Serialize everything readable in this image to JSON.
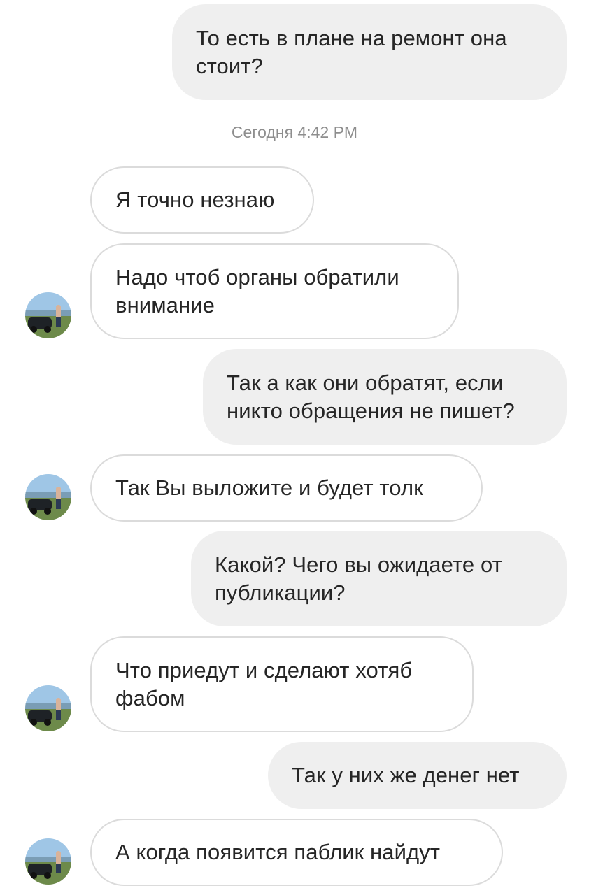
{
  "chat": {
    "timestamp": "Сегодня 4:42 PM",
    "messages": [
      {
        "from": "me",
        "text": "То есть в плане на ремонт она стоит?"
      },
      {
        "from": "them",
        "text": "Я точно незнаю"
      },
      {
        "from": "them",
        "text": "Надо чтоб органы обратили внимание"
      },
      {
        "from": "me",
        "text": "Так а как они обратят, если никто обращения не пишет?"
      },
      {
        "from": "them",
        "text": "Так Вы выложите и будет толк"
      },
      {
        "from": "me",
        "text": "Какой? Чего вы ожидаете от публикации?"
      },
      {
        "from": "them",
        "text": "Что приедут и сделают хотяб фабом"
      },
      {
        "from": "me",
        "text": "Так у них же денег нет"
      },
      {
        "from": "them",
        "text": "А когда появится паблик найдут"
      }
    ]
  },
  "colors": {
    "outgoing_bubble": "#efefef",
    "incoming_border": "#dbdbdb",
    "text": "#262626",
    "timestamp": "#8e8e8e"
  },
  "icons": {
    "avatar": "contact-avatar-photo"
  }
}
